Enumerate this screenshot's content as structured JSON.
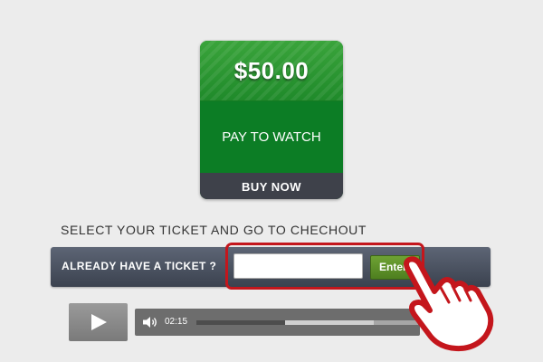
{
  "offer": {
    "price": "$50.00",
    "description": "PAY TO WATCH",
    "buy_label": "BUY NOW"
  },
  "checkout": {
    "heading": "SELECT YOUR TICKET AND GO TO CHECHOUT",
    "ticket_label": "ALREADY HAVE A TICKET ?",
    "ticket_input_value": "",
    "enter_label": "Enter"
  },
  "player": {
    "time": "02:15",
    "progress": 0.4,
    "buffered": 0.8,
    "icons": [
      "play-icon",
      "volume-icon"
    ]
  },
  "colors": {
    "price_green": "#2f9a33",
    "card_green": "#0c7d25",
    "buy_bar": "#3e414a",
    "ticket_bar": "#4b5260",
    "enter_green": "#5e9129",
    "highlight_red": "#c4161c"
  }
}
